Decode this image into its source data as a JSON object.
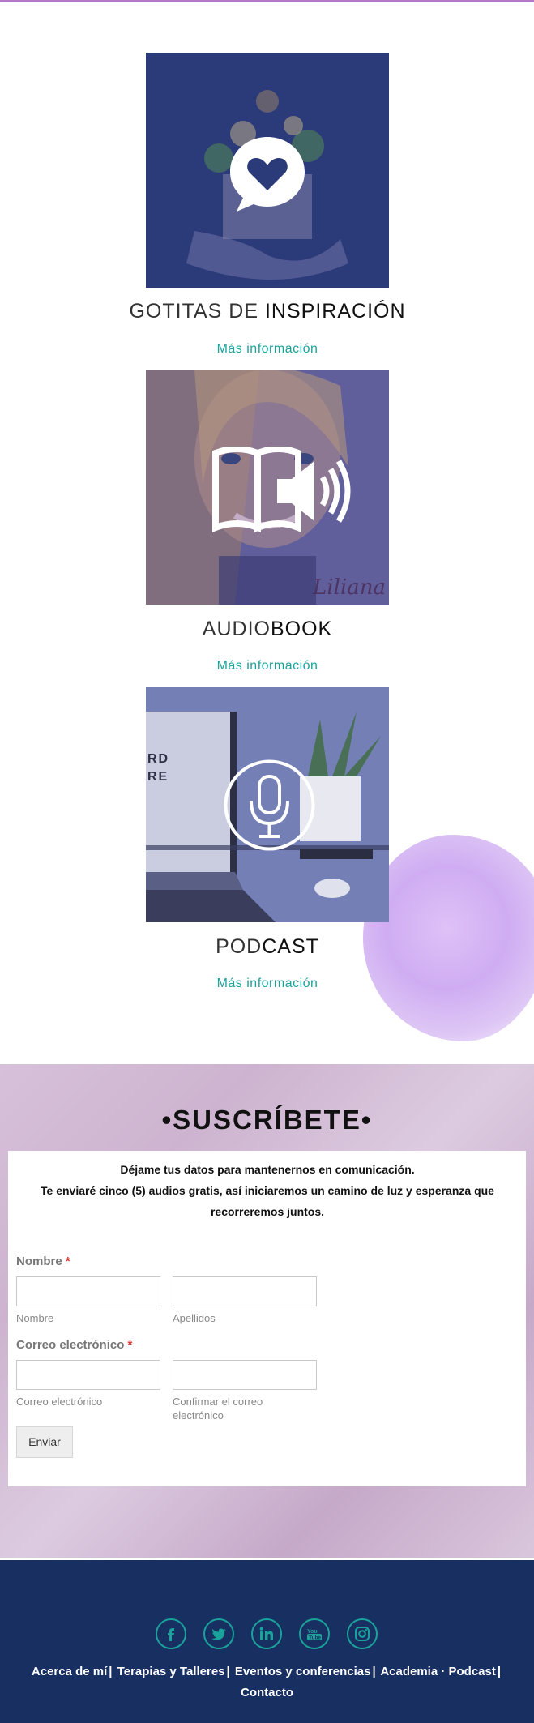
{
  "cards": [
    {
      "title_light": "GOTITAS DE ",
      "title_bold": "INSPIRACIÓN",
      "link": "Más información",
      "icon": "heart-speech-bubble-icon"
    },
    {
      "title_light": "AUDIO",
      "title_bold": "BOOK",
      "link": "Más información",
      "icon": "audiobook-icon",
      "signature": "Liliana"
    },
    {
      "title_light": "POD",
      "title_bold": "CAST",
      "link": "Más información",
      "icon": "microphone-icon",
      "laptop_text": "RD\nRE"
    }
  ],
  "subscribe": {
    "title": "•SUSCRÍBETE•",
    "intro_line1": "Déjame tus datos para mantenernos en comunicación.",
    "intro_line2": "Te enviaré cinco (5) audios gratis, así iniciaremos un camino de luz y esperanza que recorreremos juntos.",
    "name_label": "Nombre",
    "required_mark": "*",
    "first_name_sub": "Nombre",
    "last_name_sub": "Apellidos",
    "email_label": "Correo electrónico",
    "email_sub": "Correo electrónico",
    "email_confirm_sub": "Confirmar el correo electrónico",
    "submit": "Enviar"
  },
  "footer": {
    "social": [
      "facebook-icon",
      "twitter-icon",
      "linkedin-icon",
      "youtube-icon",
      "instagram-icon"
    ],
    "nav": [
      "Acerca de mí",
      "Terapias y Talleres",
      "Eventos y conferencias",
      "Academia · Podcast",
      "Contacto"
    ],
    "separator": "|"
  },
  "colors": {
    "accent": "#1aa39a",
    "footer_bg": "#182f62",
    "card_overlay": "#2d3c7a",
    "required": "#dd3333"
  }
}
